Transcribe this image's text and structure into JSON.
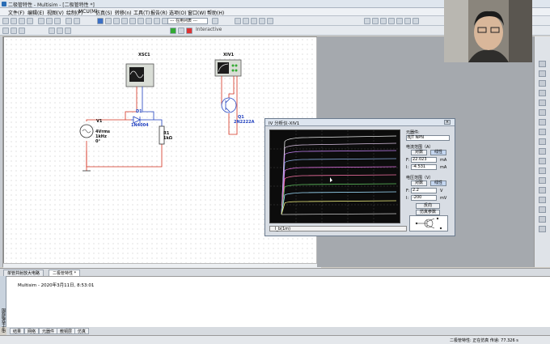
{
  "window": {
    "title": "二极管特性 - Multisim - [二极管特性 *]"
  },
  "menu": [
    "文件(F)",
    "编辑(E)",
    "视图(V)",
    "绘制(P)",
    "MCU(M)",
    "仿真(S)",
    "转移(n)",
    "工具(T)",
    "报告(R)",
    "选项(O)",
    "窗口(W)",
    "帮助(H)"
  ],
  "toolbar": {
    "combo_label": "--- 在用列表 ---",
    "interactive_label": "Interactive"
  },
  "circuit": {
    "oscilloscope": "XSC1",
    "iv_analyzer": "XIV1",
    "diode": {
      "ref": "D1",
      "part": "1N4004"
    },
    "source": {
      "ref": "V1",
      "value1": "4Vrms",
      "value2": "1kHz",
      "value3": "0°"
    },
    "resistor": {
      "ref": "R1",
      "value": "1kΩ"
    },
    "transistor": {
      "ref": "Q1",
      "part": "2N2222A"
    }
  },
  "iv_window": {
    "title": "IV 分析仪-XIV1",
    "component_label": "元器件:",
    "component_value": "BJT NPN",
    "current_range_label": "电流范围（A）",
    "voltage_range_label": "电压范围（V）",
    "log_btn": "对数",
    "linear_btn": "线性",
    "i_f_label": "F:",
    "i_f_value": "22.023",
    "i_f_unit": "mA",
    "i_i_label": "I:",
    "i_i_value": "-4.531",
    "i_i_unit": "mA",
    "v_f_label": "F:",
    "v_f_value": "2.2",
    "v_f_unit": "V",
    "v_i_label": "I:",
    "v_i_value": "-200",
    "v_i_unit": "mV",
    "reverse_btn": "反向",
    "sim_params_btn": "仿真参数",
    "scroll_label": "I_b(1m)"
  },
  "doc_tabs": [
    "单管共射放大电路",
    "二极管特性 *"
  ],
  "output": {
    "text": "Multisim  -  2020年3月11日, 8:53:01"
  },
  "spreadsheet_label": "电子表格视图",
  "bottom_tabs": [
    "结果",
    "网络",
    "元器件",
    "敷铜层",
    "仿真"
  ],
  "status": {
    "text": "二极管特性: 正在仿真  传递: 77.326 s"
  },
  "colors": {
    "accent": "#3b6fc4",
    "wire_red": "#d4301f",
    "wire_blue": "#1f3fbf",
    "trace": "#e8e8e8"
  }
}
